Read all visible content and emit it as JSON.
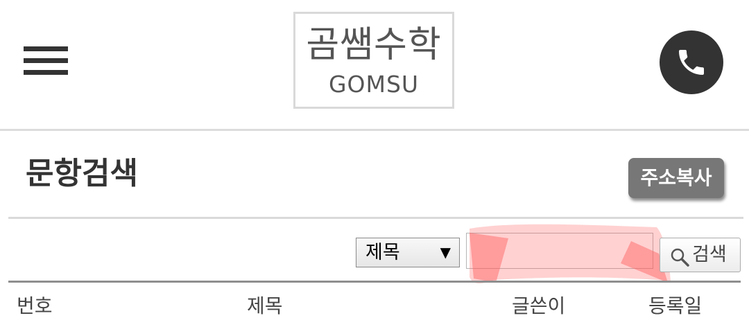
{
  "header": {
    "menu_icon": "hamburger-menu-icon",
    "logo": {
      "title": "곰쌤수학",
      "subtitle": "GOMSU"
    },
    "phone_icon": "phone-icon"
  },
  "page": {
    "title": "문항검색",
    "copy_button_label": "주소복사"
  },
  "search": {
    "field_select": {
      "selected": "제목",
      "arrow": "▼"
    },
    "query": {
      "value": "",
      "placeholder": ""
    },
    "button_label": "검색",
    "button_icon": "magnifier-icon"
  },
  "table": {
    "columns": [
      "번호",
      "제목",
      "글쓴이",
      "등록일"
    ]
  },
  "colors": {
    "dark": "#333333",
    "copy_button_bg": "#777777",
    "divider": "#d9d9d9",
    "redaction": "#ff5a5a"
  }
}
